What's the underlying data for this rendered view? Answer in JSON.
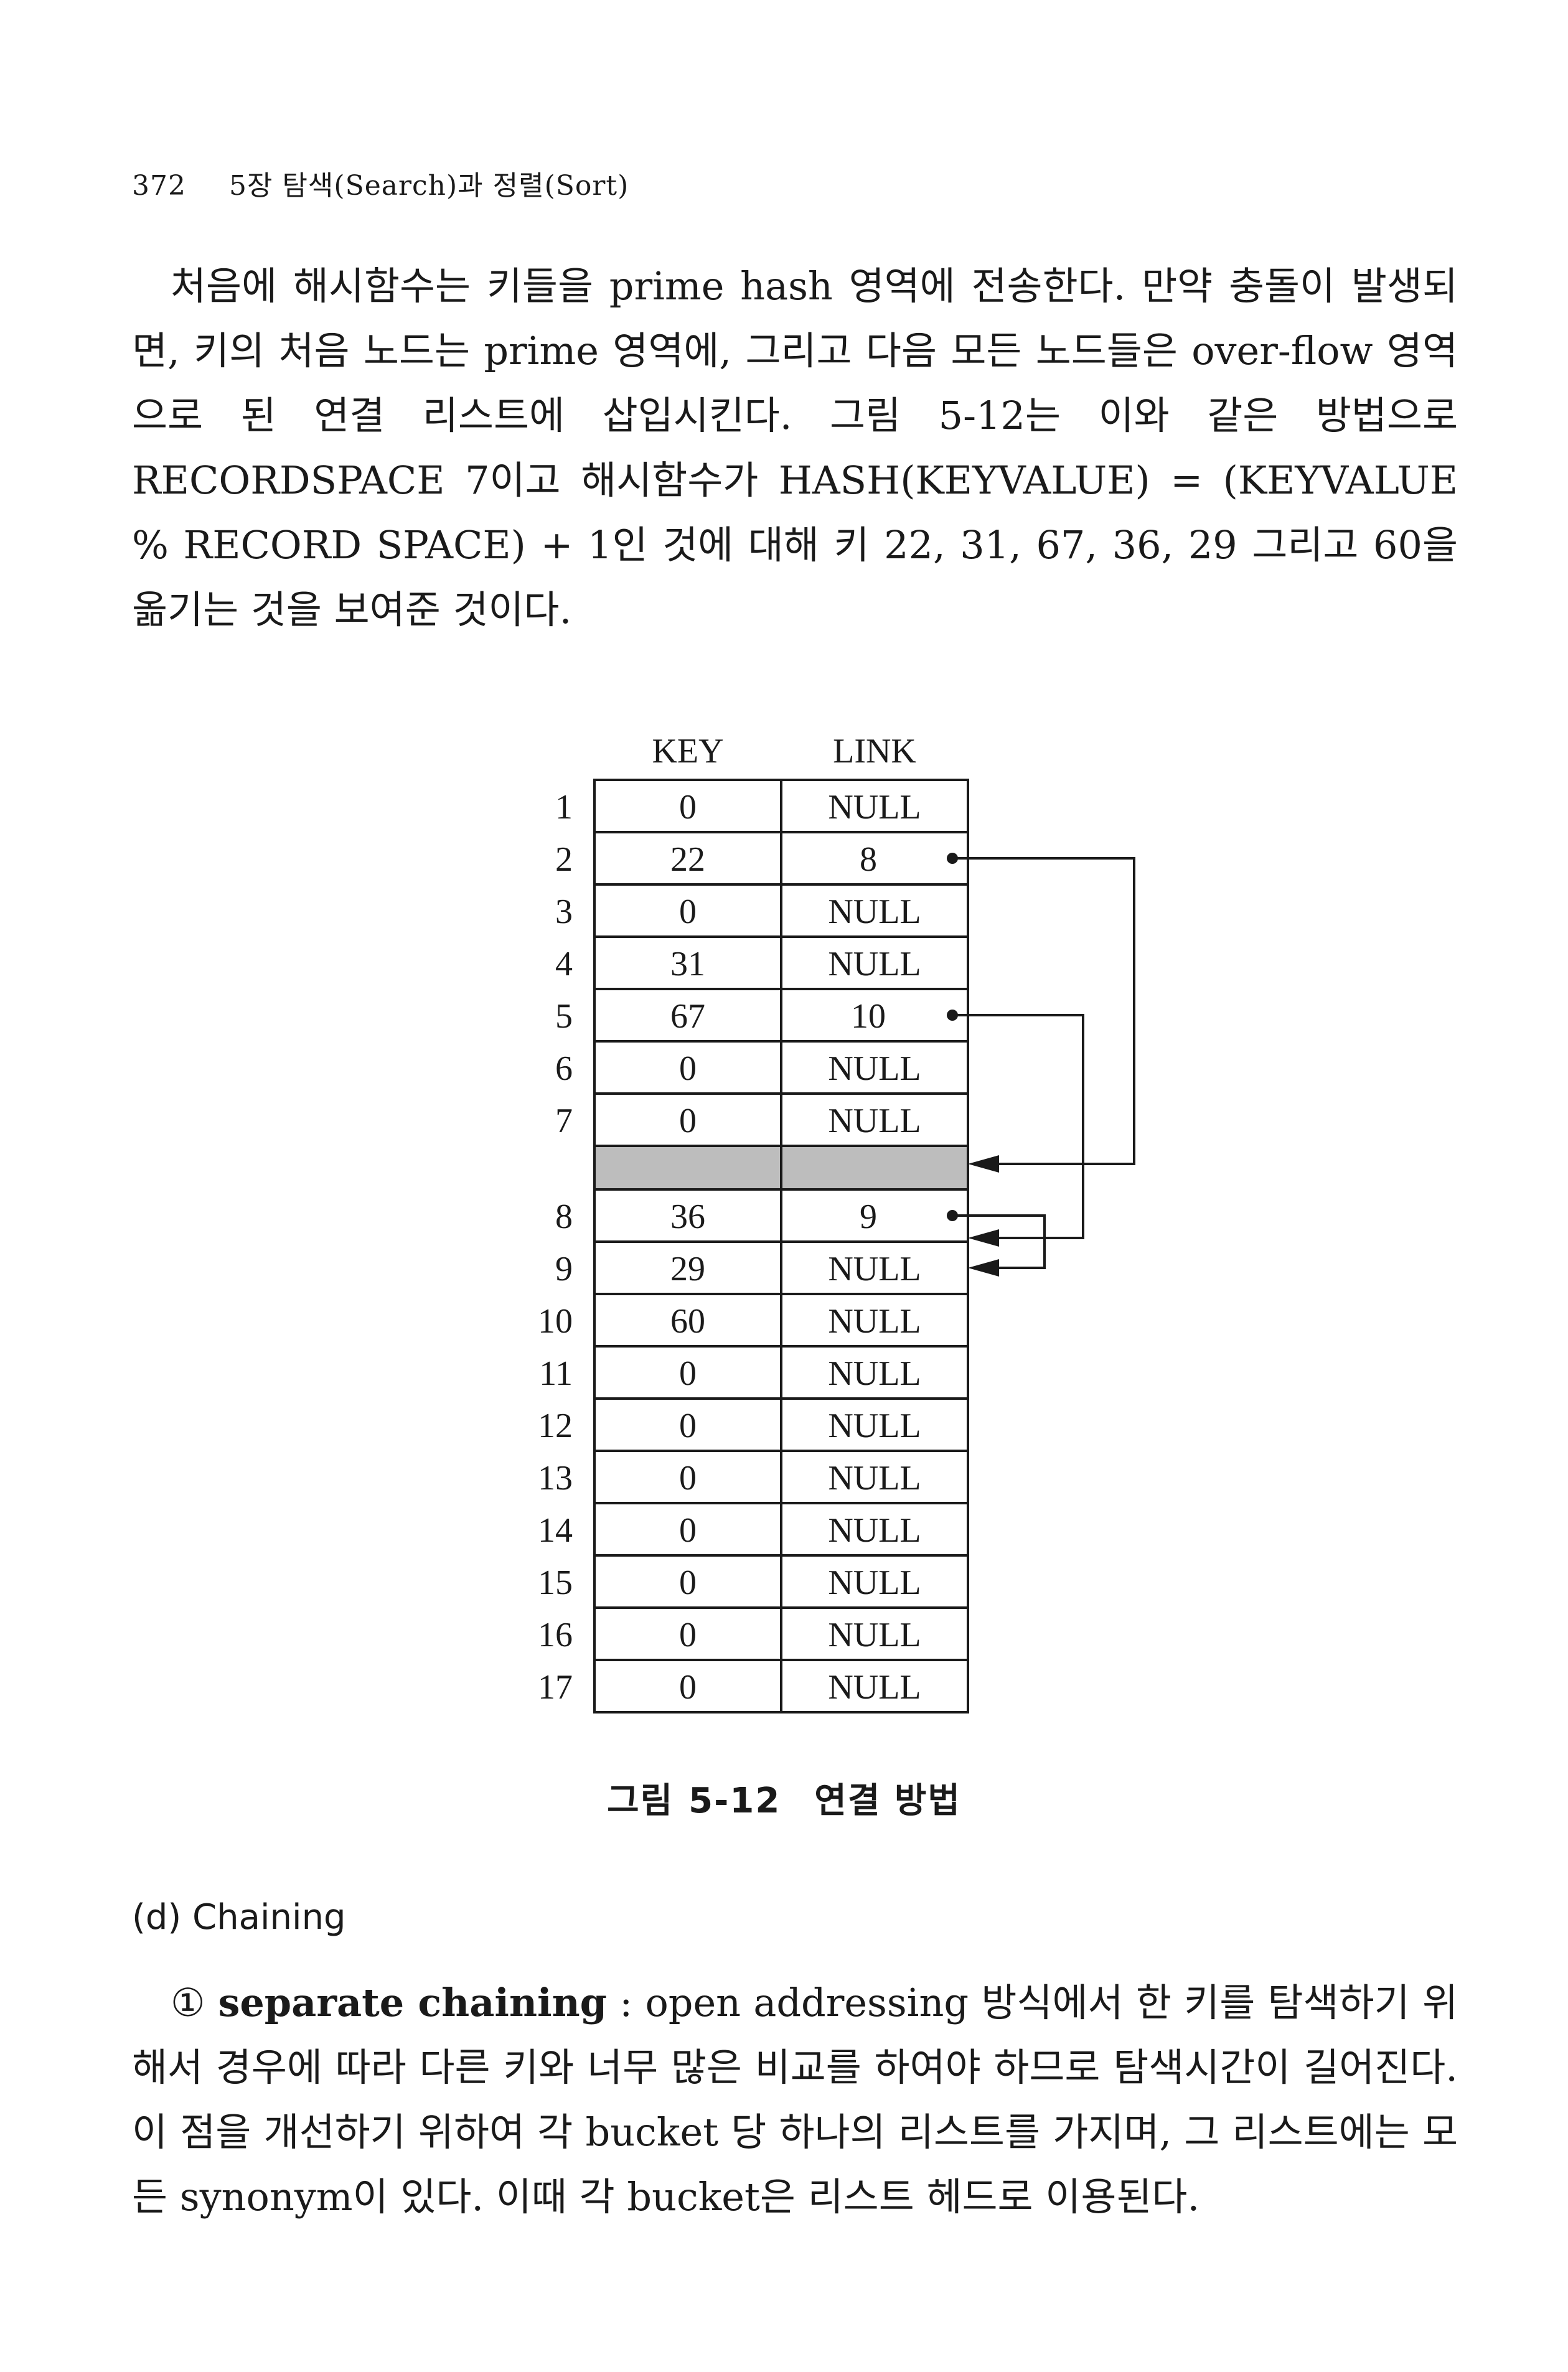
{
  "header": {
    "page_number": "372",
    "chapter": "5장 탐색(Search)과 정렬(Sort)"
  },
  "paragraph1": "처음에 해시함수는 키들을 prime hash 영역에 전송한다. 만약 충돌이 발생되면, 키의 처음 노드는 prime 영역에, 그리고 다음 모든 노드들은 over-flow 영역으로 된 연결 리스트에 삽입시킨다. 그림 5-12는 이와 같은 방법으로 RECORDSPACE 7이고 해시함수가 HASH(KEYVALUE) = (KEYVALUE % RECORD SPACE) + 1인 것에 대해 키 22, 31, 67, 36, 29 그리고 60을 옮기는 것을 보여준 것이다.",
  "figure": {
    "col_headers": [
      "KEY",
      "LINK"
    ],
    "prime_rows": [
      {
        "idx": "1",
        "key": "0",
        "link": "NULL"
      },
      {
        "idx": "2",
        "key": "22",
        "link": "8"
      },
      {
        "idx": "3",
        "key": "0",
        "link": "NULL"
      },
      {
        "idx": "4",
        "key": "31",
        "link": "NULL"
      },
      {
        "idx": "5",
        "key": "67",
        "link": "10"
      },
      {
        "idx": "6",
        "key": "0",
        "link": "NULL"
      },
      {
        "idx": "7",
        "key": "0",
        "link": "NULL"
      }
    ],
    "overflow_rows": [
      {
        "idx": "8",
        "key": "36",
        "link": "9"
      },
      {
        "idx": "9",
        "key": "29",
        "link": "NULL"
      },
      {
        "idx": "10",
        "key": "60",
        "link": "NULL"
      },
      {
        "idx": "11",
        "key": "0",
        "link": "NULL"
      },
      {
        "idx": "12",
        "key": "0",
        "link": "NULL"
      },
      {
        "idx": "13",
        "key": "0",
        "link": "NULL"
      },
      {
        "idx": "14",
        "key": "0",
        "link": "NULL"
      },
      {
        "idx": "15",
        "key": "0",
        "link": "NULL"
      },
      {
        "idx": "16",
        "key": "0",
        "link": "NULL"
      },
      {
        "idx": "17",
        "key": "0",
        "link": "NULL"
      }
    ],
    "caption_prefix": "그림",
    "caption_number": "5-12",
    "caption_title": "연결 방법",
    "colors": {
      "line": "#1a1a1a",
      "separator_fill": "#bdbdbd"
    }
  },
  "subheading": "(d) Chaining",
  "paragraph2": {
    "marker": "①",
    "term": "separate chaining",
    "text": " : open addressing 방식에서 한 키를 탐색하기 위해서 경우에 따라 다른 키와 너무 많은 비교를 하여야 하므로 탐색시간이 길어진다. 이 점을 개선하기 위하여 각 bucket 당 하나의 리스트를 가지며, 그 리스트에는 모든 synonym이 있다. 이때 각 bucket은 리스트 헤드로 이용된다."
  }
}
